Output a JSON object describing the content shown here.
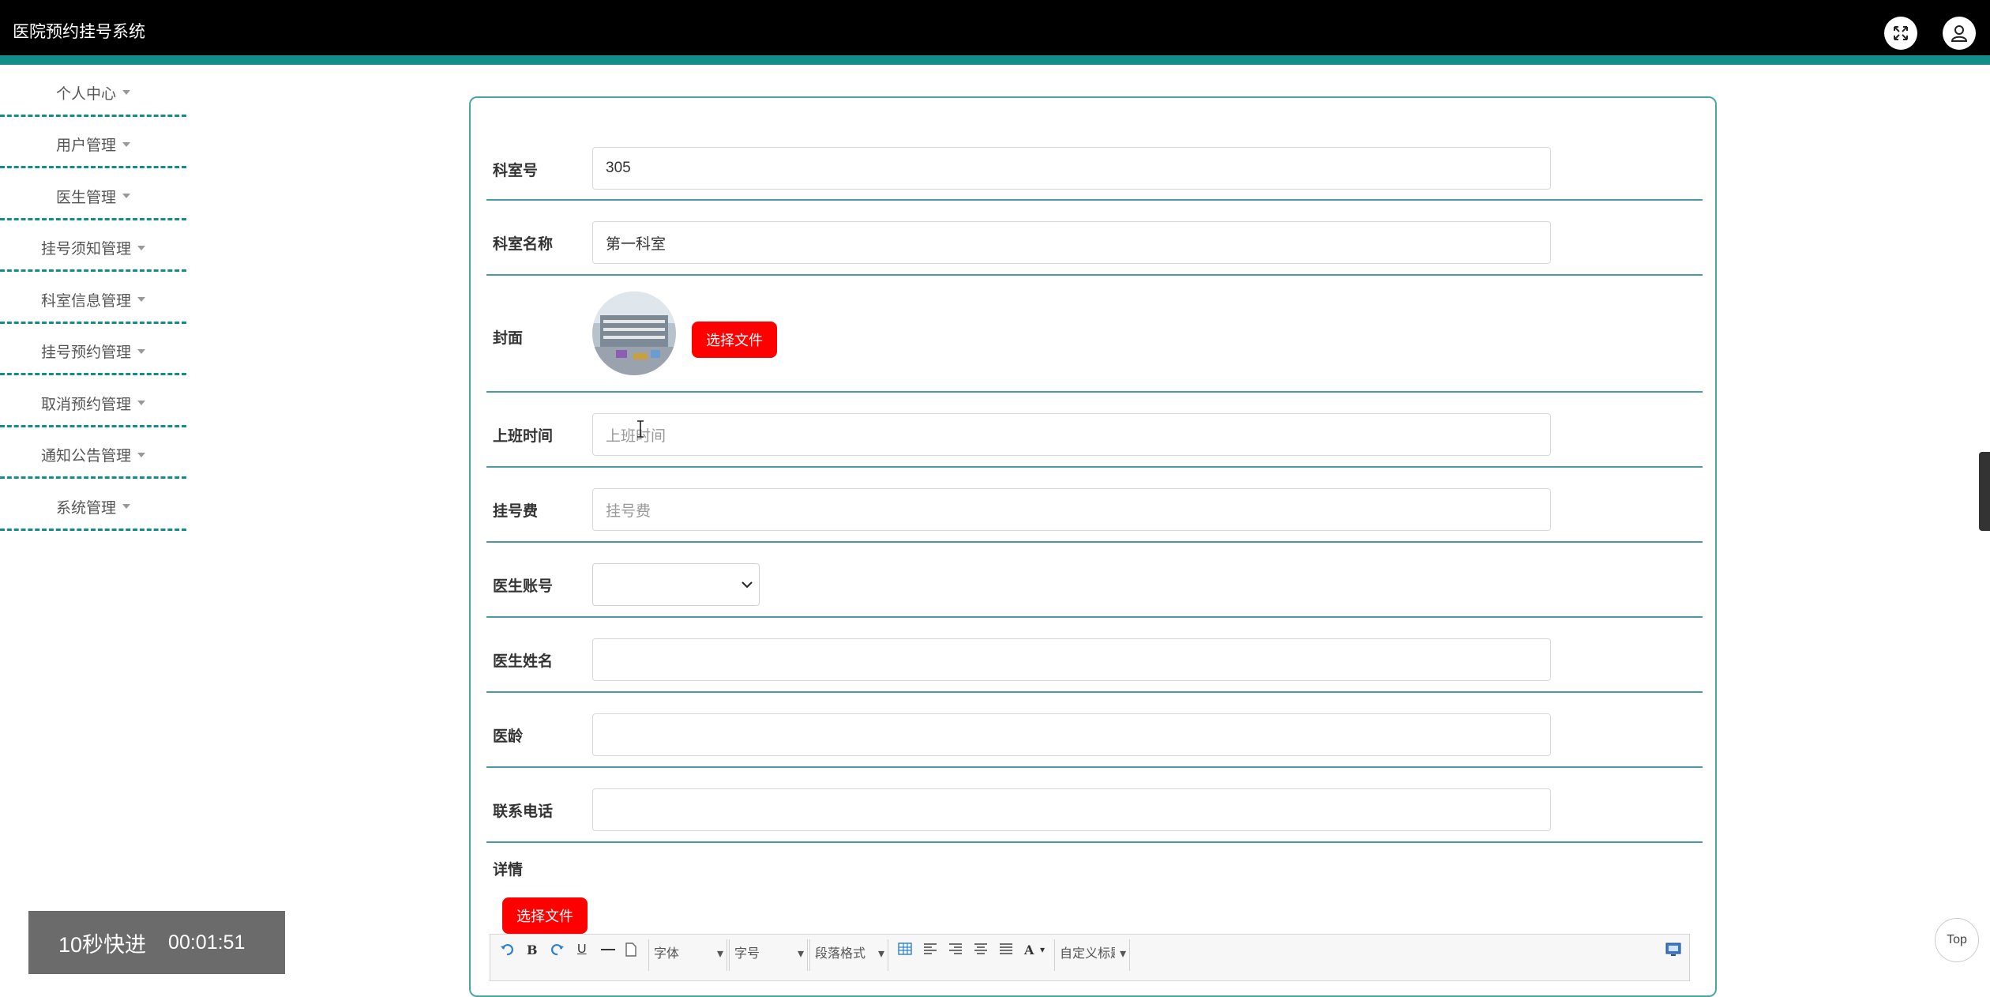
{
  "header": {
    "app_title": "医院预约挂号系统",
    "fullscreen_icon": "expand-icon",
    "user_icon": "user-icon"
  },
  "sidebar": {
    "items": [
      {
        "label": "个人中心"
      },
      {
        "label": "用户管理"
      },
      {
        "label": "医生管理"
      },
      {
        "label": "挂号须知管理"
      },
      {
        "label": "科室信息管理"
      },
      {
        "label": "挂号预约管理"
      },
      {
        "label": "取消预约管理"
      },
      {
        "label": "通知公告管理"
      },
      {
        "label": "系统管理"
      }
    ]
  },
  "form": {
    "room_no": {
      "label": "科室号",
      "value": "305"
    },
    "room_name": {
      "label": "科室名称",
      "value": "第一科室"
    },
    "cover": {
      "label": "封面",
      "button": "选择文件"
    },
    "work_time": {
      "label": "上班时间",
      "placeholder": "上班时间"
    },
    "fee": {
      "label": "挂号费",
      "placeholder": "挂号费"
    },
    "doctor_account": {
      "label": "医生账号",
      "value": ""
    },
    "doctor_name": {
      "label": "医生姓名",
      "value": ""
    },
    "doctor_age": {
      "label": "医龄",
      "value": ""
    },
    "phone": {
      "label": "联系电话",
      "value": ""
    },
    "detail": {
      "label": "详情",
      "button": "选择文件"
    }
  },
  "editor_toolbar": {
    "bold": "B",
    "underline": "U",
    "font_family": "字体",
    "font_size": "字号",
    "paragraph": "段落格式",
    "font_color": "A",
    "custom_title": "自定义标题"
  },
  "player": {
    "label": "10秒快进",
    "time": "00:01:51"
  },
  "top_button": "Top",
  "colors": {
    "teal": "#138d88",
    "red_button": "#ff0000",
    "header_bg": "#000000"
  }
}
